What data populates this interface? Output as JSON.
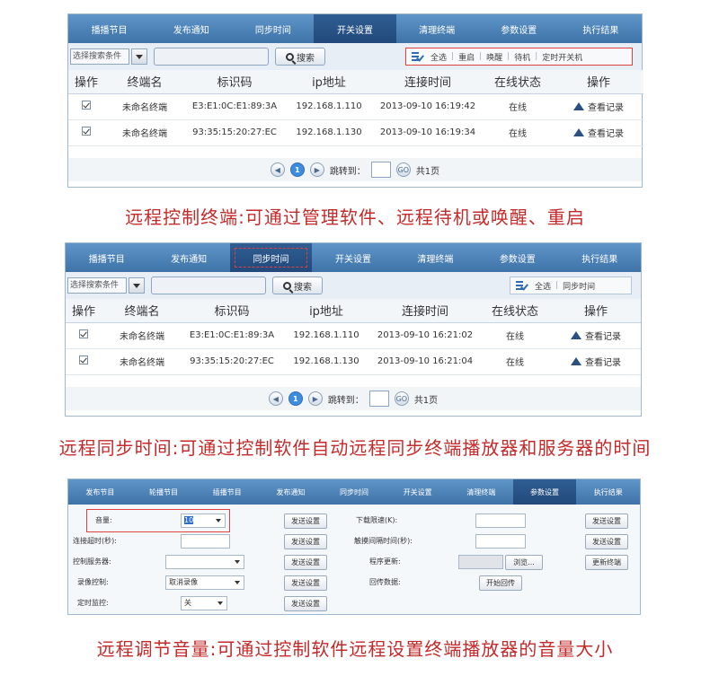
{
  "panel1": {
    "nav": [
      "播播节目",
      "发布通知",
      "同步时间",
      "开关设置",
      "清理终端",
      "参数设置",
      "执行结果"
    ],
    "active_index": 3,
    "search_select": "选择搜索条件",
    "search_button": "搜索",
    "actions": [
      "全选",
      "重启",
      "唤醒",
      "待机",
      "定时开关机"
    ],
    "headers": [
      "操作",
      "终端名",
      "标识码",
      "ip地址",
      "连接时间",
      "在线状态",
      "操作"
    ],
    "rows": [
      {
        "name": "未命名终端",
        "id": "E3:E1:0C:E1:89:3A",
        "ip": "192.168.1.110",
        "time": "2013-09-10 16:19:42",
        "status": "在线",
        "action": "查看记录"
      },
      {
        "name": "未命名终端",
        "id": "93:35:15:20:27:EC",
        "ip": "192.168.1.130",
        "time": "2013-09-10 16:19:34",
        "status": "在线",
        "action": "查看记录"
      }
    ],
    "pager": {
      "page": "1",
      "jump": "跳转到：",
      "go": "GO",
      "total": "共1页"
    }
  },
  "caption1": "远程控制终端:可通过管理软件、远程待机或唤醒、重启",
  "panel2": {
    "nav": [
      "播播节目",
      "发布通知",
      "同步时间",
      "开关设置",
      "清理终端",
      "参数设置",
      "执行结果"
    ],
    "active_index": 2,
    "search_select": "选择搜索条件",
    "search_button": "搜索",
    "actions": [
      "全选",
      "同步时间"
    ],
    "headers": [
      "操作",
      "终端名",
      "标识码",
      "ip地址",
      "连接时间",
      "在线状态",
      "操作"
    ],
    "rows": [
      {
        "name": "未命名终端",
        "id": "E3:E1:0C:E1:89:3A",
        "ip": "192.168.1.110",
        "time": "2013-09-10 16:21:02",
        "status": "在线",
        "action": "查看记录"
      },
      {
        "name": "未命名终端",
        "id": "93:35:15:20:27:EC",
        "ip": "192.168.1.130",
        "time": "2013-09-10 16:21:04",
        "status": "在线",
        "action": "查看记录"
      }
    ],
    "pager": {
      "page": "1",
      "jump": "跳转到：",
      "go": "GO",
      "total": "共1页"
    }
  },
  "caption2": "远程同步时间:可通过控制软件自动远程同步终端播放器和服务器的时间",
  "panel3": {
    "nav": [
      "发布节目",
      "轮播节目",
      "插播节目",
      "发布通知",
      "同步时间",
      "开关设置",
      "清理终端",
      "参数设置",
      "执行结果"
    ],
    "active_index": 7,
    "labels": {
      "volume": "音量:",
      "conn_timeout": "连接超时(秒):",
      "control_server": "控制服务器:",
      "record_control": "录像控制:",
      "timer_monitor": "定时监控:",
      "download_speed": "下载限速(K):",
      "touch_interval": "触摸间隔时间(秒):",
      "program_update": "程序更新:",
      "return_data": "回传数据:"
    },
    "values": {
      "volume": "10",
      "record_control": "取消录像",
      "timer_monitor": "关"
    },
    "buttons": {
      "send": "发送设置",
      "browse": "浏览...",
      "update_terminal": "更新终端",
      "start_return": "开始回传"
    }
  },
  "caption3": "远程调节音量:可通过控制软件远程设置终端播放器的音量大小",
  "colors": {
    "nav_blue": "#3f73a8",
    "caption_red": "#c42a2a",
    "online_blue": "#2a6ad0",
    "terminal_orange": "#e08a00"
  }
}
